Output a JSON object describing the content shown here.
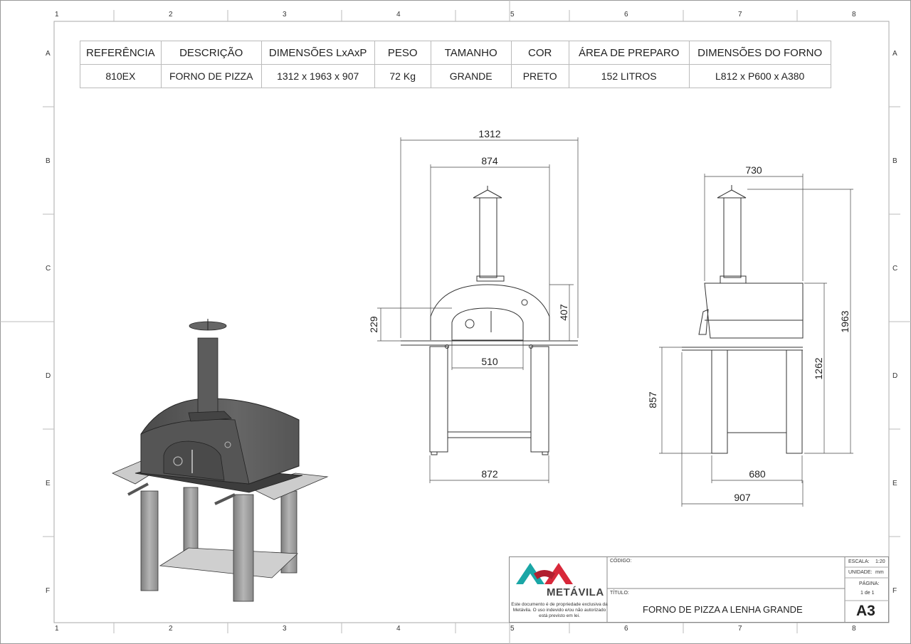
{
  "ruler": {
    "columns": [
      "1",
      "2",
      "3",
      "4",
      "5",
      "6",
      "7",
      "8"
    ],
    "rows": [
      "A",
      "B",
      "C",
      "D",
      "E",
      "F"
    ]
  },
  "spec_table": {
    "headers": [
      "REFERÊNCIA",
      "DESCRIÇÃO",
      "DIMENSÕES LxAxP",
      "PESO",
      "TAMANHO",
      "COR",
      "ÁREA DE PREPARO",
      "DIMENSÕES DO FORNO"
    ],
    "values": [
      "810EX",
      "FORNO DE PIZZA",
      "1312 x 1963 x 907",
      "72 Kg",
      "GRANDE",
      "PRETO",
      "152 LITROS",
      "L812 x P600 x A380"
    ]
  },
  "front_view": {
    "dims": {
      "overall_width": "1312",
      "dome_width": "874",
      "oven_height": "407",
      "door_height": "229",
      "door_width": "510",
      "stand_width": "872"
    }
  },
  "side_view": {
    "dims": {
      "top_depth": "730",
      "total_height": "1963",
      "table_height": "1262",
      "counter_height": "857",
      "stand_depth": "680",
      "overall_depth": "907"
    }
  },
  "title_block": {
    "codigo_label": "CÓDIGO:",
    "titulo_label": "TÍTULO:",
    "title": "FORNO DE PIZZA A LENHA GRANDE",
    "escala_label": "ESCALA:",
    "escala_value": "1:20",
    "unidade_label": "UNIDADE:",
    "unidade_value": "mm",
    "pagina_label": "PÁGINA:",
    "pagina_value": "1 de 1",
    "size": "A3",
    "company": "METÁVILA",
    "disclaimer": "Este documento é de propriedade exclusiva da Metávila. O uso indevido e/ou não autorizado está previsto em lei."
  },
  "colors": {
    "brand_teal": "#1aa6a6",
    "brand_red": "#d8283a",
    "oven_dark": "#5a5a5a",
    "leg_grey": "#9a9a9a",
    "counter_grey": "#c8c8c8"
  }
}
